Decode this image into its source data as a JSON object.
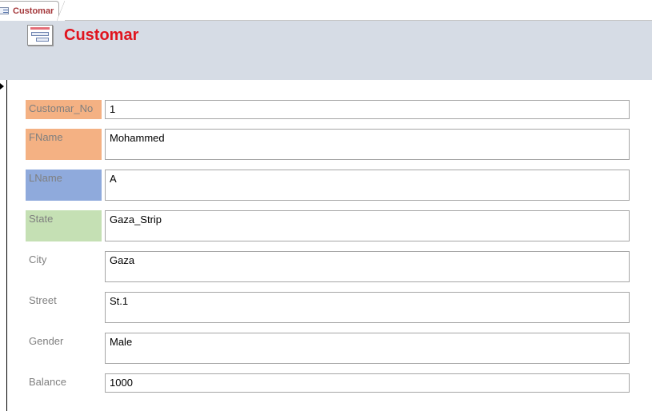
{
  "tab": {
    "label": "Customar",
    "icon": "form-icon"
  },
  "header": {
    "title": "Customar",
    "icon": "form-icon"
  },
  "record_selector": {
    "icon": "current-record-arrow-icon"
  },
  "colors": {
    "title": "#e0141e",
    "tab_label": "#a4373a",
    "header_bg": "#d6dce5",
    "label_orange": "#f4b183",
    "label_blue": "#8faadc",
    "label_green": "#c5e0b4"
  },
  "fields": [
    {
      "label": "Customar_No",
      "value": "1"
    },
    {
      "label": "FName",
      "value": "Mohammed"
    },
    {
      "label": "LName",
      "value": "A"
    },
    {
      "label": "State",
      "value": "Gaza_Strip"
    },
    {
      "label": "City",
      "value": "Gaza"
    },
    {
      "label": "Street",
      "value": "St.1"
    },
    {
      "label": "Gender",
      "value": "Male"
    },
    {
      "label": "Balance",
      "value": "1000"
    }
  ]
}
